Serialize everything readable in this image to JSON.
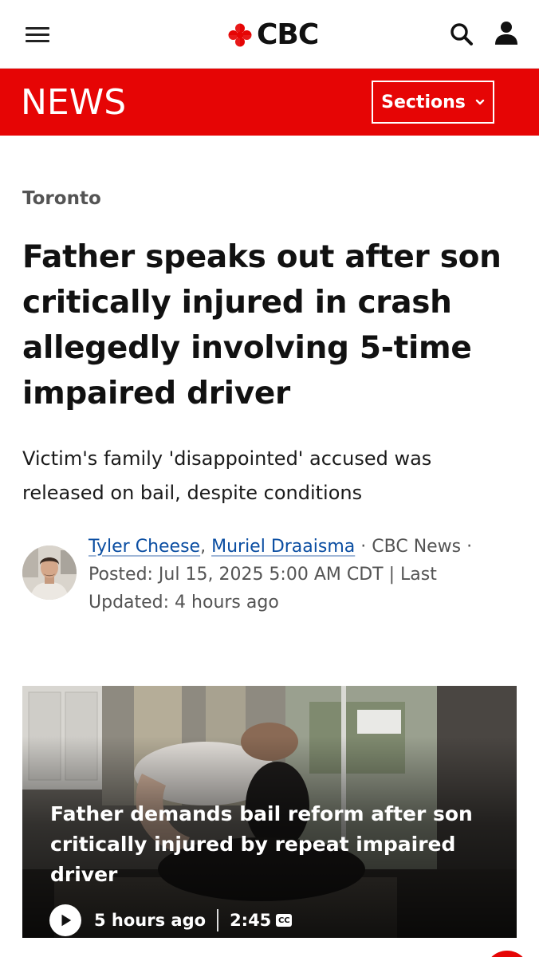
{
  "header": {
    "logo_text": "CBC",
    "logo_icon": "cbc-gem-icon",
    "menu_icon": "hamburger-menu-icon",
    "search_icon": "search-icon",
    "user_icon": "user-icon",
    "brand_color": "#e60505"
  },
  "news_bar": {
    "title": "NEWS",
    "sections_label": "Sections",
    "sections_icon": "chevron-down-icon"
  },
  "article": {
    "category": "Toronto",
    "headline": "Father speaks out after son critically injured in crash allegedly involving 5-time impaired driver",
    "deck": "Victim's family 'disappointed' accused was released on bail, despite conditions",
    "byline": {
      "author_1": "Tyler Cheese",
      "separator_comma": ",",
      "author_2": "Muriel Draaisma",
      "dot_1": "·",
      "outlet": "CBC News",
      "dot_2": "·",
      "dates": "Posted: Jul 15, 2025 5:00 AM CDT | Last Updated: 4 hours ago"
    }
  },
  "video": {
    "title": "Father demands bail reform after son critically injured by repeat impaired driver",
    "time_ago": "5 hours ago",
    "duration": "2:45",
    "cc_label": "CC",
    "play_icon": "play-icon"
  }
}
